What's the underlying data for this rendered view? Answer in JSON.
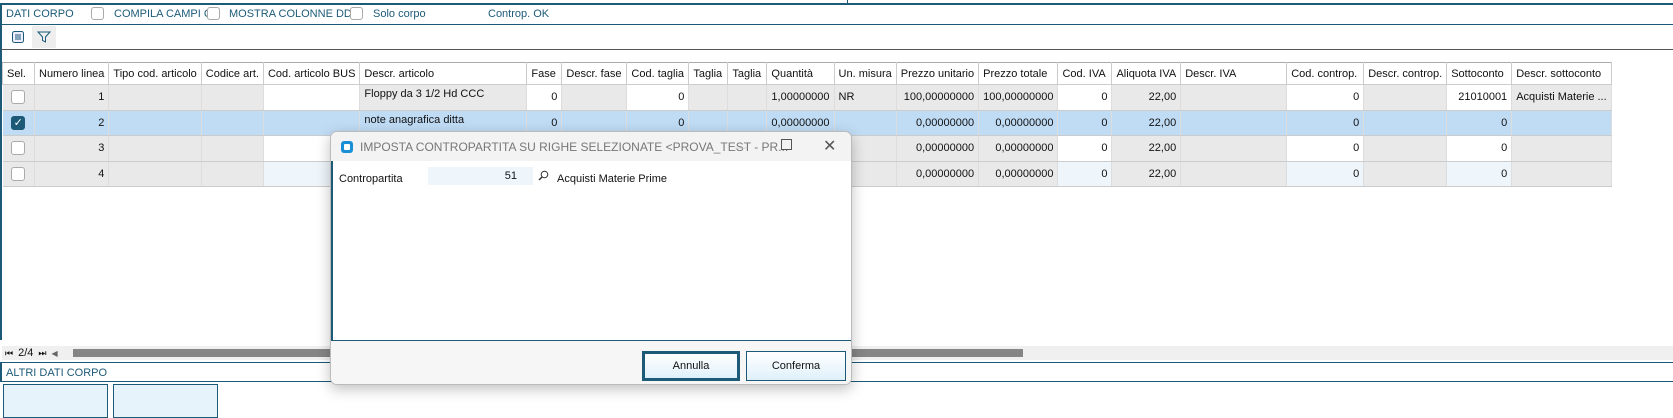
{
  "header": {
    "section": "DATI CORPO",
    "compila": "COMPILA CAMPI CG",
    "mostra": "MOSTRA COLONNE DDT",
    "solo": "Solo corpo",
    "status": "Controp. OK"
  },
  "grid": {
    "columns": [
      "Sel.",
      "Numero linea",
      "Tipo cod. articolo",
      "Codice art.",
      "Cod. articolo BUS",
      "Descr. articolo",
      "Fase",
      "Descr. fase",
      "Cod. taglia",
      "Taglia",
      "Taglia",
      "Quantità",
      "Un. misura",
      "Prezzo unitario",
      "Prezzo totale",
      "Cod. IVA",
      "Aliquota IVA",
      "Descr. IVA",
      "Cod. controp.",
      "Descr. controp.",
      "Sottoconto",
      "Descr. sottoconto"
    ],
    "rows": [
      {
        "selected": false,
        "cells": [
          "",
          "1",
          "",
          "",
          "",
          "Floppy da 3 1/2 Hd CCC",
          "0",
          "",
          "0",
          "",
          "",
          "1,00000000",
          "NR",
          "100,00000000",
          "100,00000000",
          "0",
          "22,00",
          "",
          "0",
          "",
          "21010001",
          "Acquisti Materie ..."
        ]
      },
      {
        "selected": true,
        "cells": [
          "",
          "2",
          "",
          "",
          "",
          "note anagrafica ditta",
          "0",
          "",
          "0",
          "",
          "",
          "0,00000000",
          "",
          "0,00000000",
          "0,00000000",
          "0",
          "22,00",
          "",
          "0",
          "",
          "0",
          ""
        ]
      },
      {
        "selected": false,
        "cells": [
          "",
          "3",
          "",
          "",
          "",
          "",
          "",
          "",
          "",
          "",
          "",
          "",
          "",
          "0,00000000",
          "0,00000000",
          "0",
          "22,00",
          "",
          "0",
          "",
          "0",
          ""
        ]
      },
      {
        "selected": false,
        "cells": [
          "",
          "4",
          "",
          "",
          "",
          "",
          "",
          "",
          "",
          "",
          "",
          "",
          "",
          "0,00000000",
          "0,00000000",
          "0",
          "22,00",
          "",
          "0",
          "",
          "0",
          ""
        ]
      }
    ]
  },
  "pager": {
    "position": "2/4"
  },
  "footer": {
    "section": "ALTRI DATI CORPO"
  },
  "dialog": {
    "title": "IMPOSTA CONTROPARTITA SU RIGHE SELEZIONATE <PROVA_TEST - PR...",
    "field_label": "Contropartita",
    "field_value": "51",
    "field_desc": "Acquisti Materie Prime",
    "cancel": "Annulla",
    "confirm": "Conferma"
  }
}
